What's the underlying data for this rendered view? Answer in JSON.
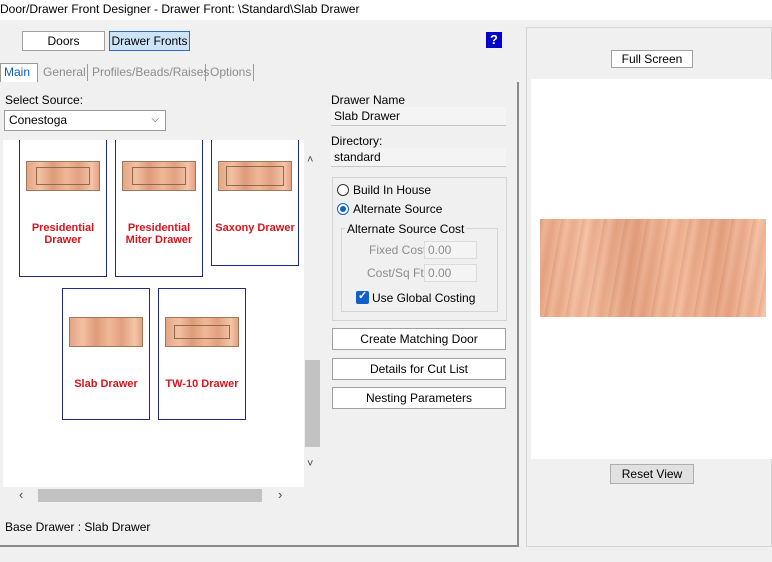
{
  "window": {
    "title": "Door/Drawer Front Designer - Drawer Front: \\Standard\\Slab Drawer"
  },
  "mode_buttons": {
    "doors": "Doors",
    "drawer_fronts": "Drawer Fronts"
  },
  "help_label": "?",
  "tabs": [
    {
      "label": "Main",
      "active": true
    },
    {
      "label": "General",
      "active": false
    },
    {
      "label": "Profiles/Beads/Raises",
      "active": false
    },
    {
      "label": "Options",
      "active": false
    }
  ],
  "source": {
    "label": "Select Source:",
    "value": "Conestoga"
  },
  "drawers": [
    {
      "name": "Presidential\nDrawer"
    },
    {
      "name": "Presidential\nMiter Drawer"
    },
    {
      "name": "Saxony Drawer"
    },
    {
      "name": "Slab Drawer"
    },
    {
      "name": "TW-10 Drawer"
    }
  ],
  "drawer_name": {
    "label": "Drawer Name",
    "value": "Slab Drawer"
  },
  "directory": {
    "label": "Directory:",
    "value": "standard"
  },
  "build": {
    "build_in_house": "Build In House",
    "alternate_source": "Alternate Source",
    "selected": "alternate_source"
  },
  "alt_cost": {
    "legend": "Alternate Source Cost",
    "fixed_cost_label": "Fixed Cost",
    "fixed_cost_value": "0.00",
    "cost_sqft_label": "Cost/Sq Ft",
    "cost_sqft_value": "0.00",
    "use_global_label": "Use Global Costing",
    "use_global_checked": true
  },
  "actions": {
    "create_matching_door": "Create Matching Door",
    "details_cut_list": "Details for Cut List",
    "nesting_parameters": "Nesting Parameters"
  },
  "status": "Base Drawer : Slab Drawer",
  "preview": {
    "full_screen": "Full Screen",
    "reset_view": "Reset View"
  },
  "colors": {
    "accent": "#1062c8",
    "label_red": "#d8141c",
    "card_border": "#1f2a87",
    "wood": "#e8aa8a"
  }
}
